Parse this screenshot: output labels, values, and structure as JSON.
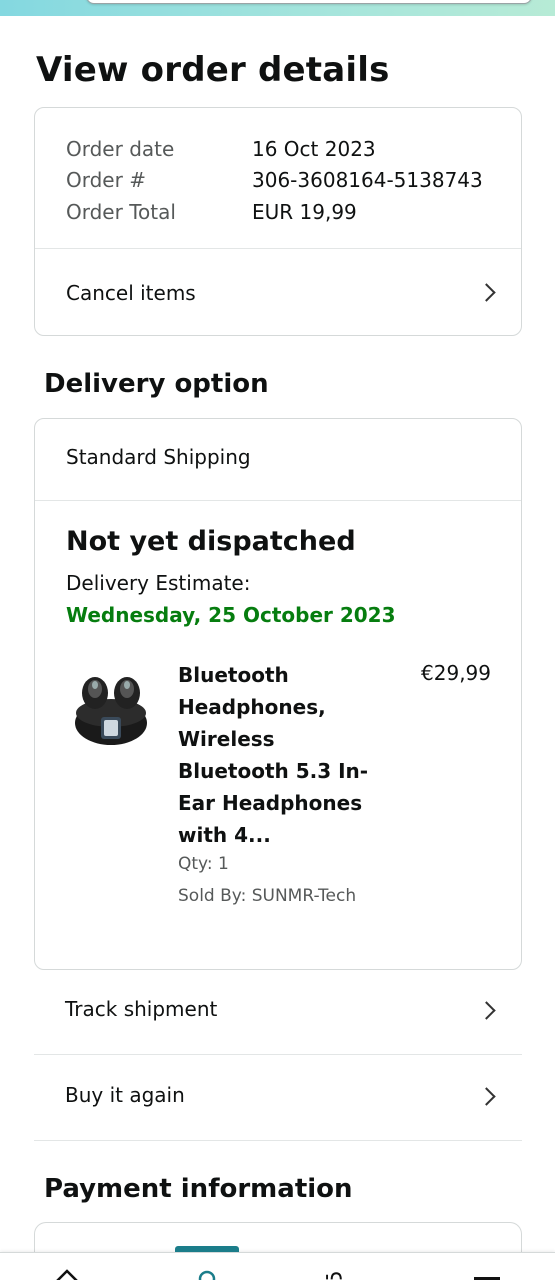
{
  "title": "View order details",
  "summary": {
    "order_date_label": "Order date",
    "order_date_value": "16 Oct 2023",
    "order_number_label": "Order #",
    "order_number_value": "306-3608164-5138743",
    "order_total_label": "Order Total",
    "order_total_value": "EUR 19,99",
    "cancel_items": "Cancel items"
  },
  "delivery": {
    "heading": "Delivery option",
    "shipping_method": "Standard Shipping",
    "status": "Not yet dispatched",
    "estimate_label": "Delivery Estimate:",
    "estimate_date": "Wednesday, 25 October 2023",
    "product": {
      "title": "Bluetooth Headphones, Wireless Bluetooth 5.3 In-Ear Headphones with 4...",
      "price": "€29,99",
      "qty": "Qty: 1",
      "sold_by": "Sold By: SUNMR-Tech"
    }
  },
  "actions": {
    "track_shipment": "Track shipment",
    "buy_again": "Buy it again"
  },
  "payment": {
    "heading": "Payment information"
  },
  "colors": {
    "accent_green": "#067d0f",
    "nav_active": "#1b7d8a",
    "header_gradient_start": "#84d8e0",
    "header_gradient_end": "#b7ebd6"
  },
  "icons": [
    "home-icon",
    "profile-icon",
    "cart-icon",
    "menu-icon",
    "chevron-right-icon"
  ]
}
